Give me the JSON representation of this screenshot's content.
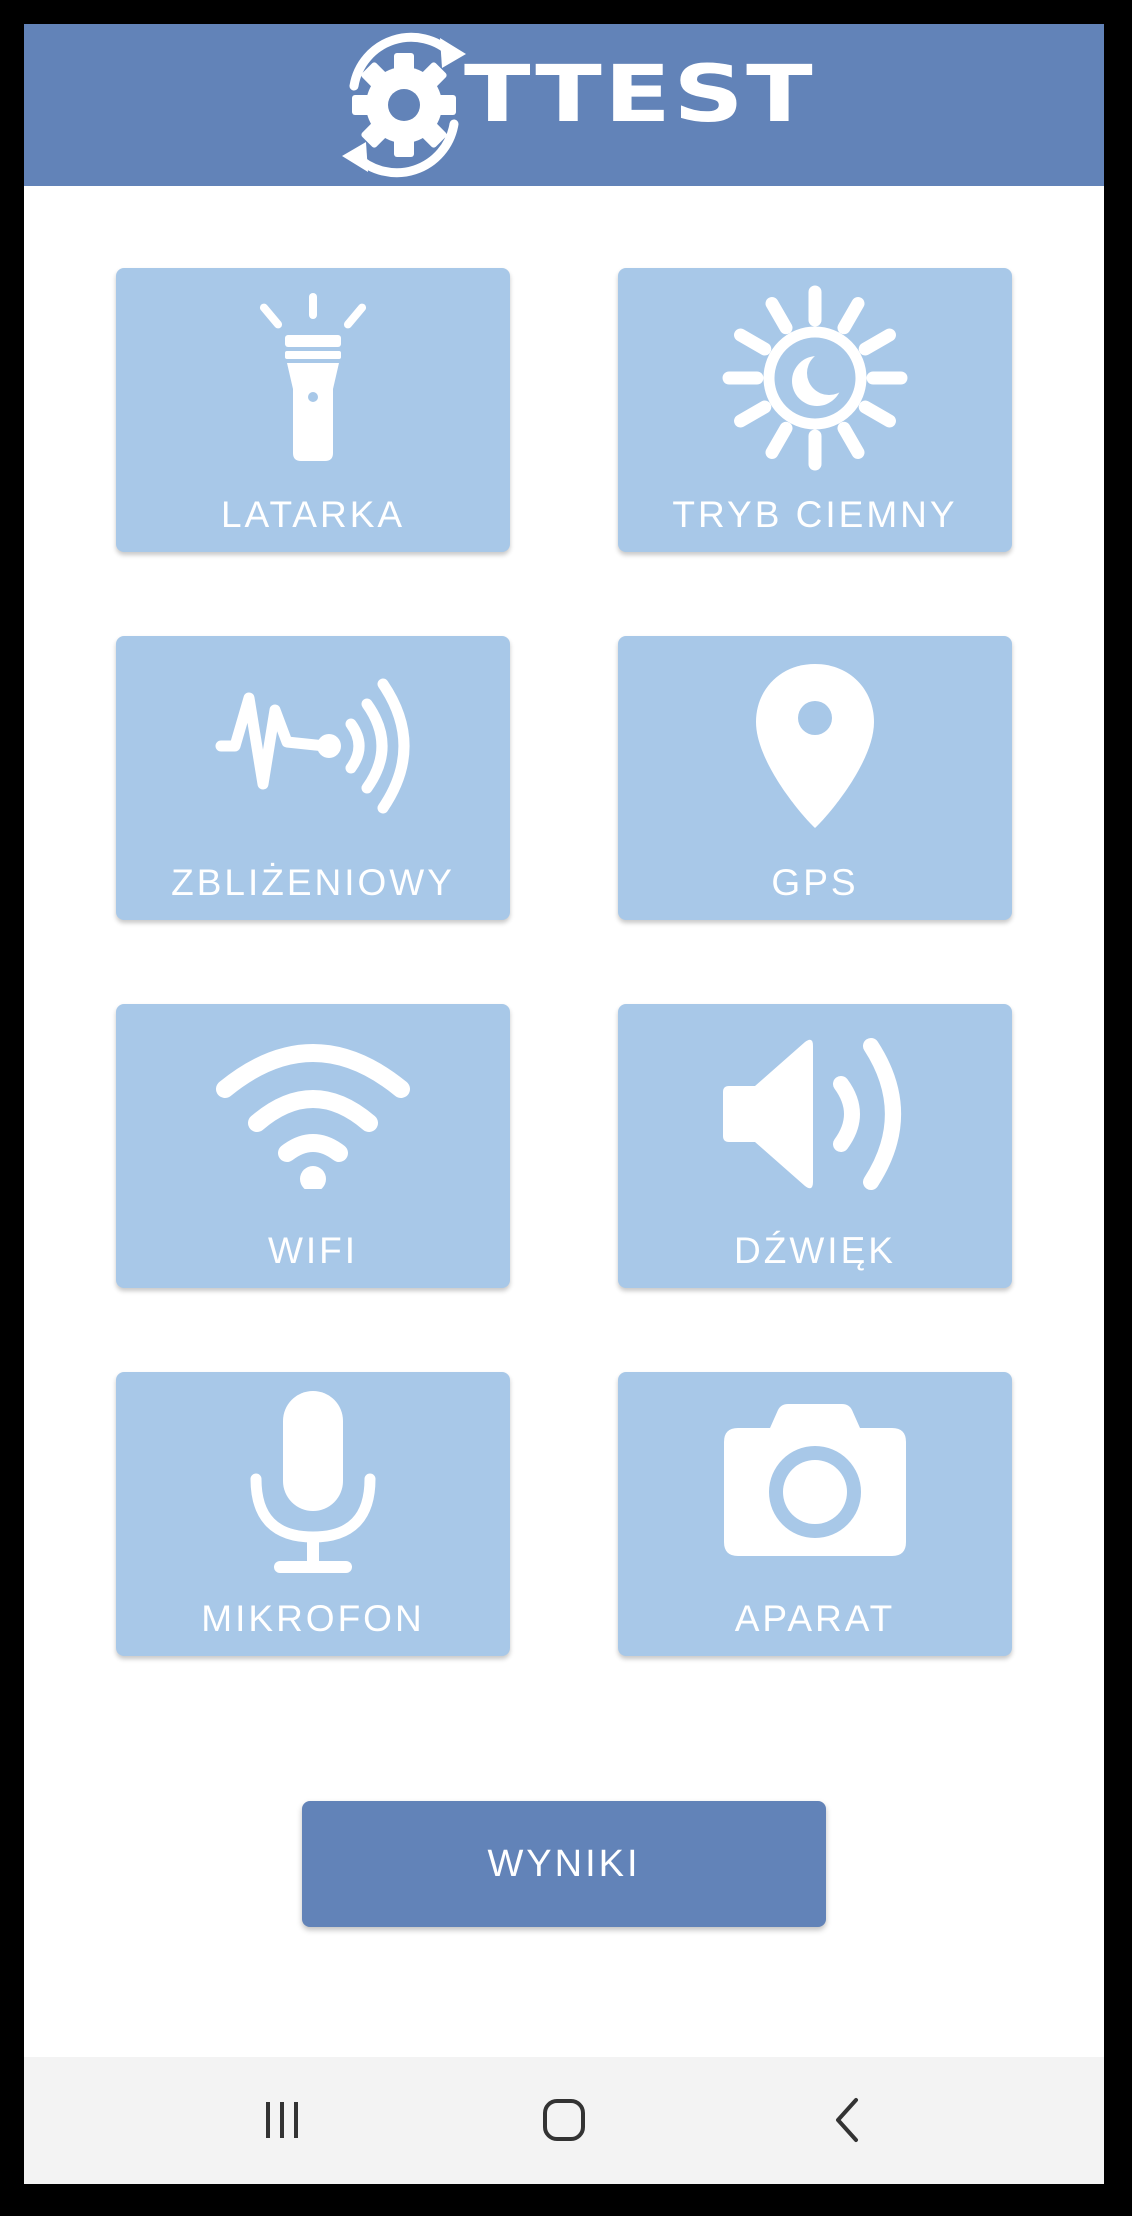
{
  "app": {
    "logo_text": "TTEST",
    "header_color": "#6283b8"
  },
  "tiles": [
    {
      "label": "LATARKA",
      "icon": "flashlight-icon"
    },
    {
      "label": "TRYB CIEMNY",
      "icon": "dark-mode-sun-moon-icon"
    },
    {
      "label": "ZBLIŻENIOWY",
      "icon": "proximity-sensor-icon"
    },
    {
      "label": "GPS",
      "icon": "location-pin-icon"
    },
    {
      "label": "WIFI",
      "icon": "wifi-icon"
    },
    {
      "label": "DŹWIĘK",
      "icon": "speaker-icon"
    },
    {
      "label": "MIKROFON",
      "icon": "microphone-icon"
    },
    {
      "label": "APARAT",
      "icon": "camera-icon"
    }
  ],
  "results_button": {
    "label": "WYNIKI"
  },
  "colors": {
    "tile": "#a8c8e8",
    "accent": "#6283b8",
    "icon": "#ffffff"
  },
  "nav": {
    "buttons": [
      "recent-apps-icon",
      "home-icon",
      "back-icon"
    ]
  }
}
